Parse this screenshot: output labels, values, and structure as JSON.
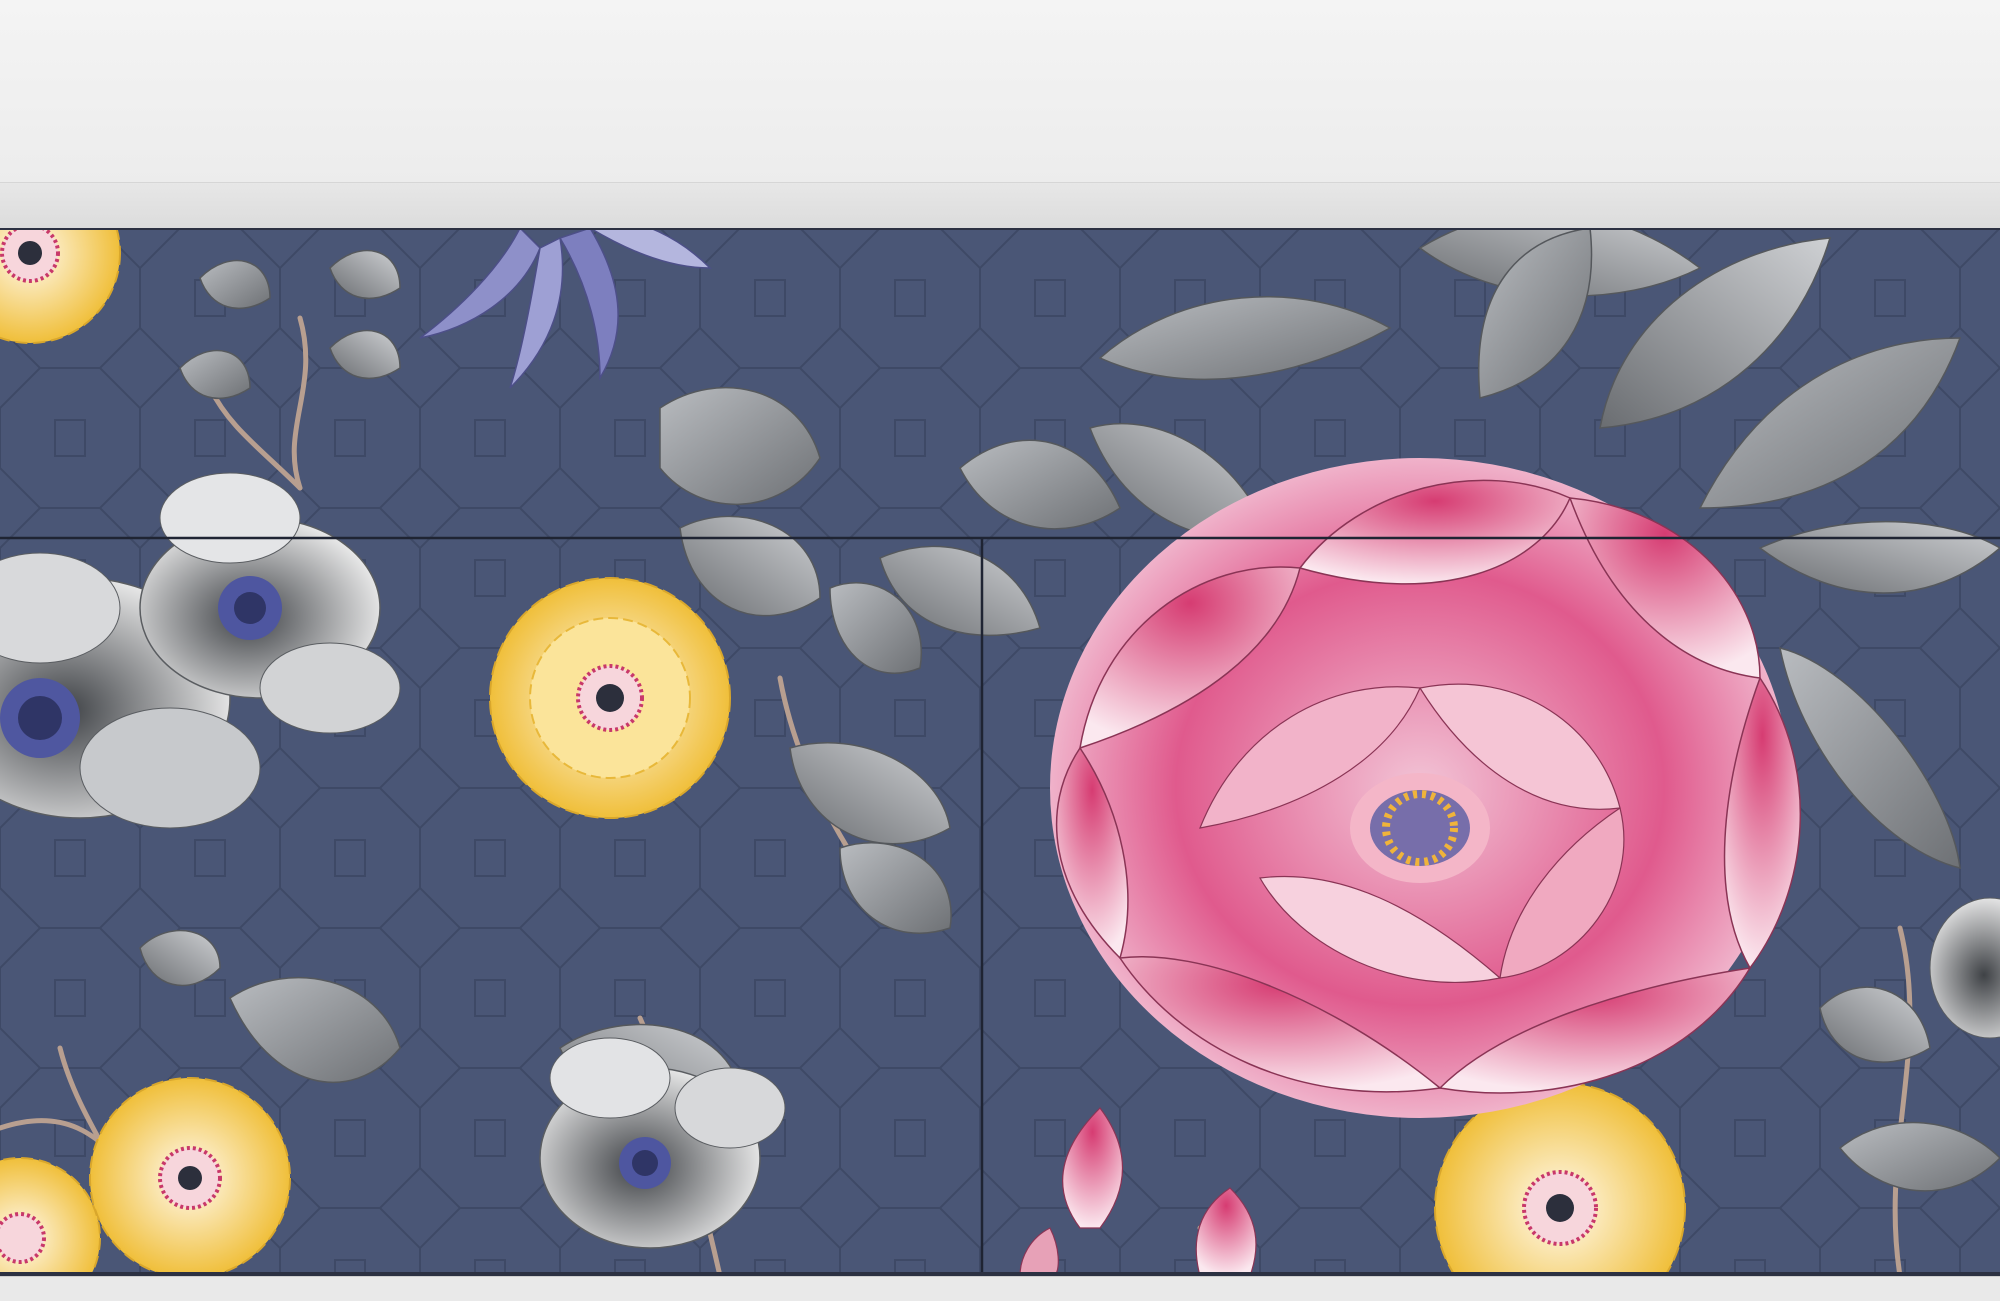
{
  "scene": {
    "description_kind": "photo-product",
    "subject": "sideboard-with-floral-vinyl-wrap"
  },
  "colors": {
    "background_wall": "#efefef",
    "panel_navy": "#4a5676",
    "lattice_line": "#3f4a68",
    "peony_pink": "#d8477a",
    "peony_light": "#f7dbe6",
    "daisy_yellow": "#f3c94c",
    "leaf_gray": "#8f9296",
    "leaf_dark": "#5d6064",
    "lily_purple": "#7d7fbf",
    "stem_brown": "#b49c8c"
  }
}
